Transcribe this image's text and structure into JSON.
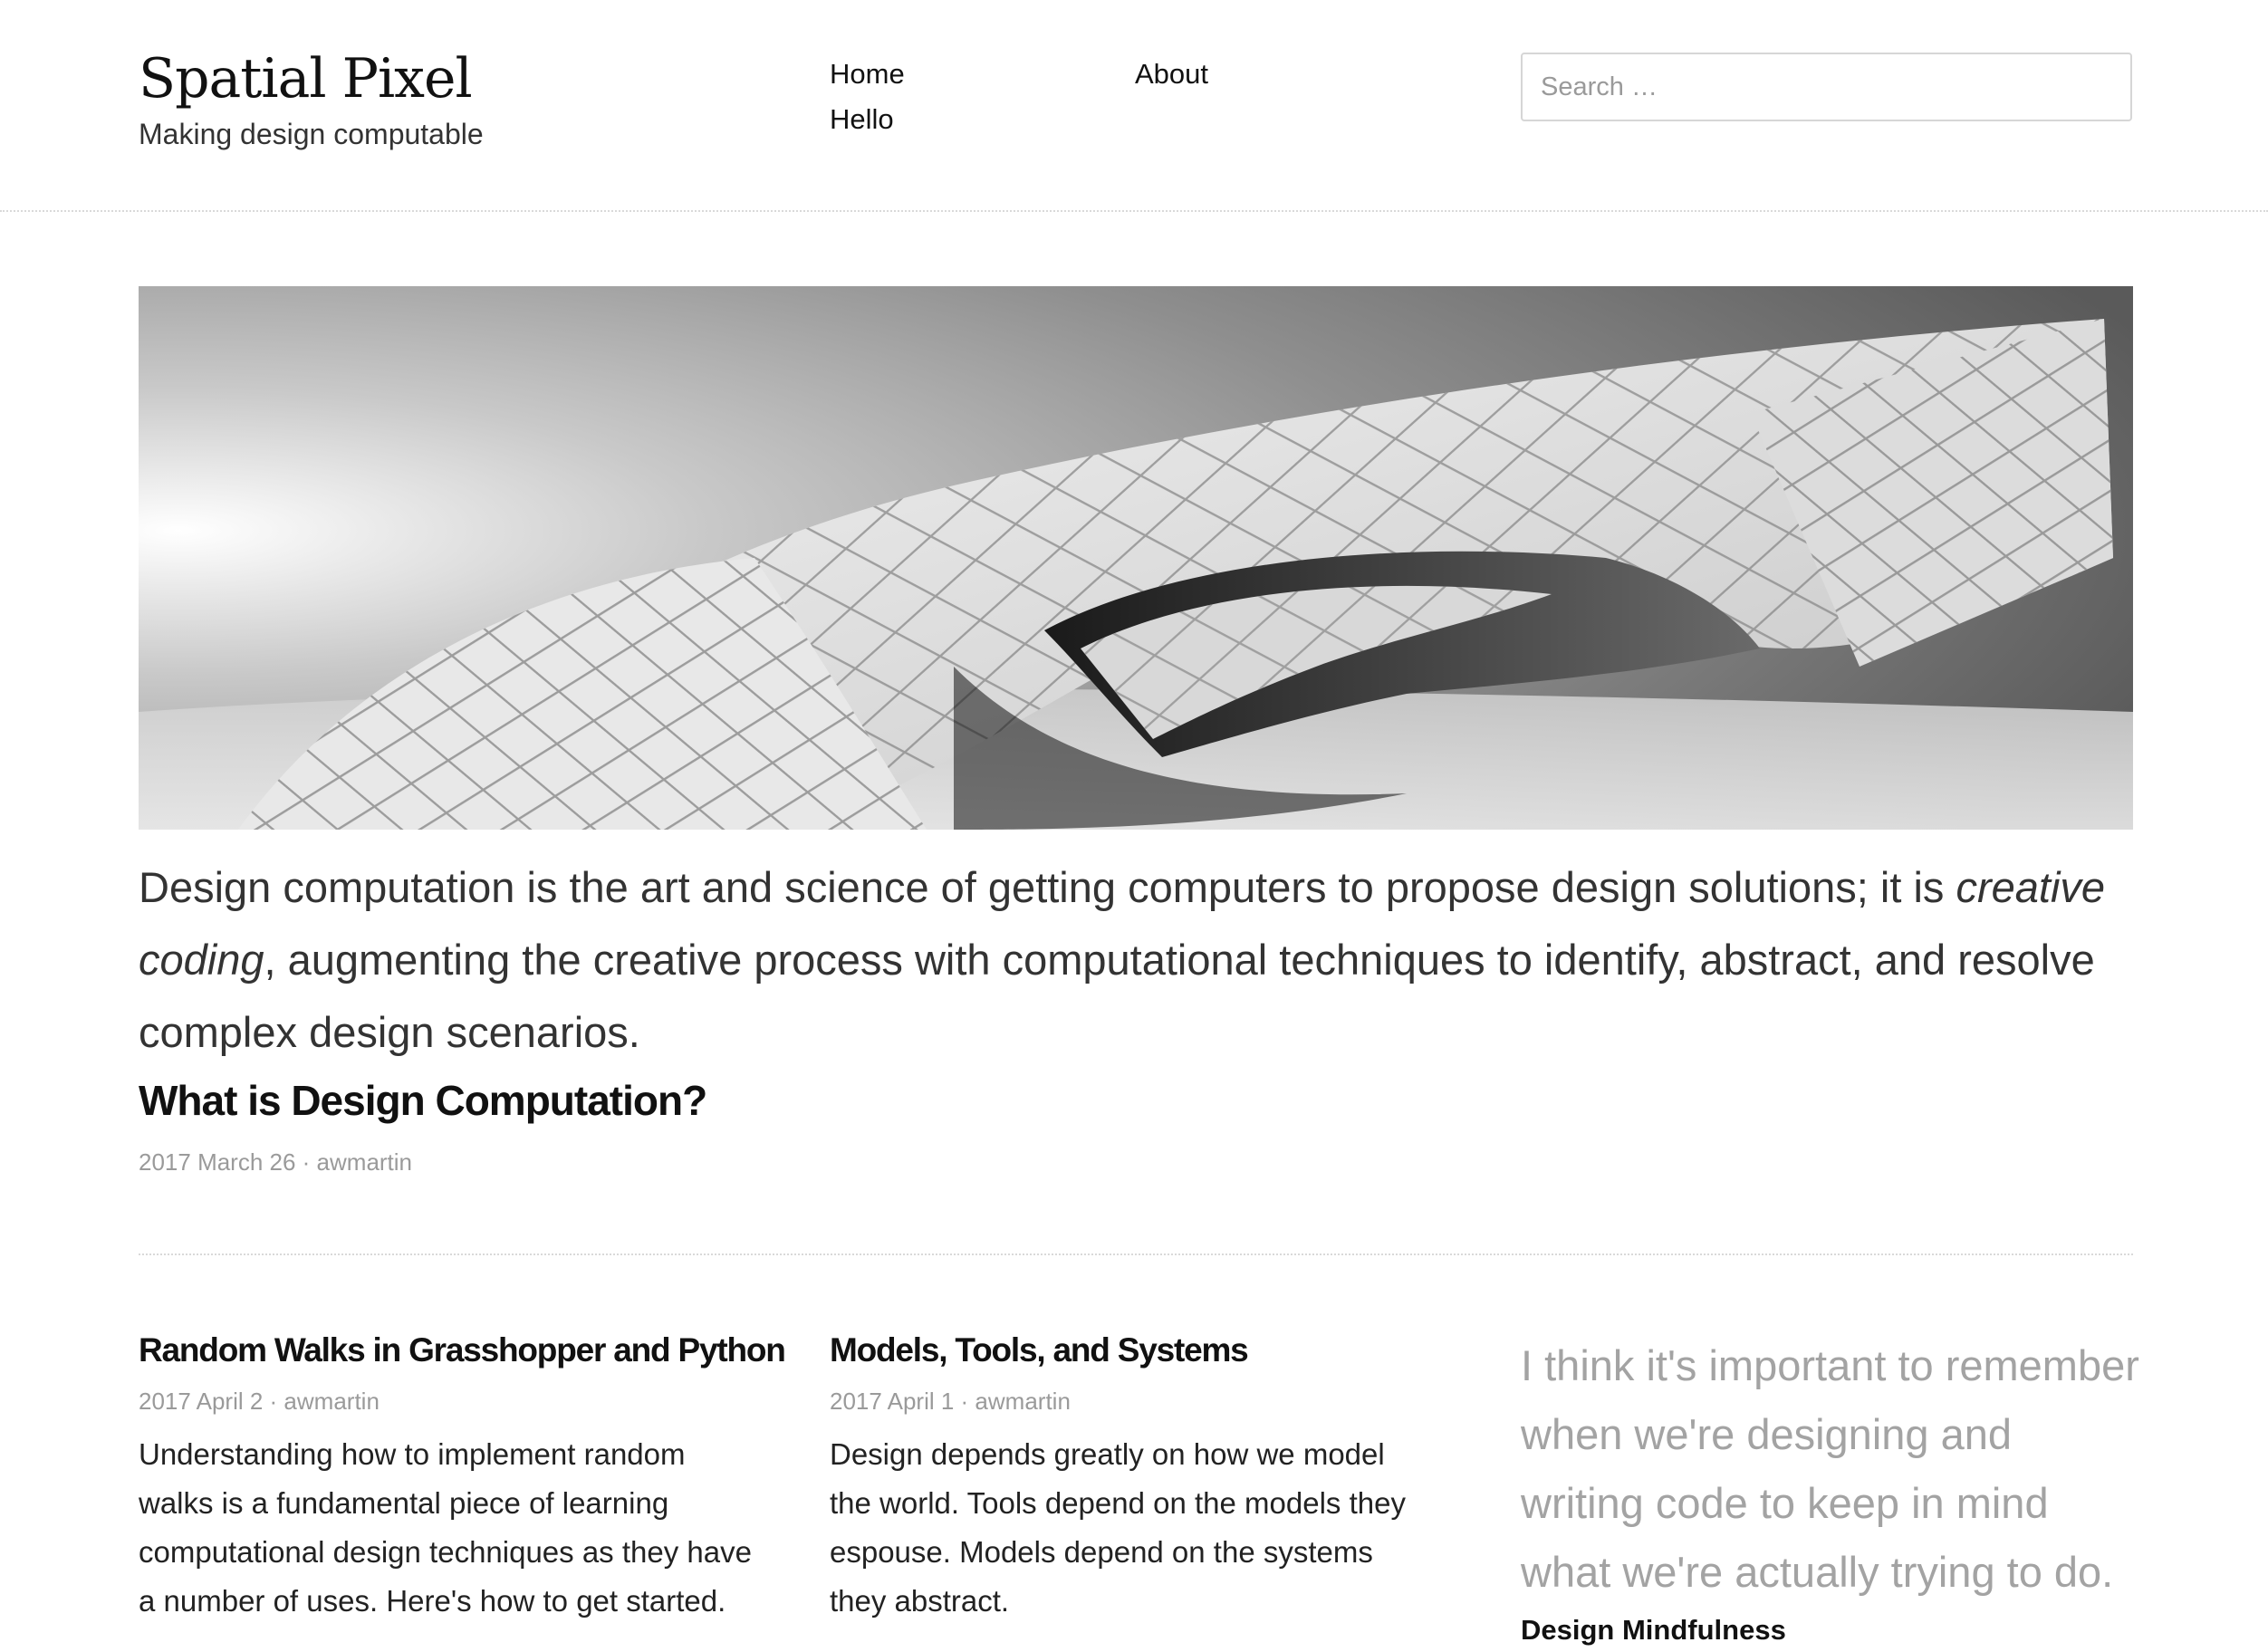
{
  "site": {
    "title": "Spatial Pixel",
    "tagline": "Making design computable"
  },
  "nav": {
    "items": [
      {
        "label": "Home"
      },
      {
        "label": "About"
      },
      {
        "label": "Hello"
      }
    ]
  },
  "search": {
    "placeholder": "Search …"
  },
  "hero": {
    "image_description": "grayscale render of a curved paneled lattice shell structure"
  },
  "intro": {
    "text_before": "Design computation is the art and science of getting computers to propose design solutions; it is ",
    "emphasis": "creative coding",
    "text_after": ", augmenting the creative process with computational techniques to identify, abstract, and resolve complex design scenarios."
  },
  "featured": {
    "title": "What is Design Computation?",
    "meta": "2017 March 26 · awmartin"
  },
  "posts": [
    {
      "title": "Random Walks in Grasshopper and Python",
      "meta": "2017 April 2 · awmartin",
      "excerpt": "Understanding how to implement random walks is a fundamental piece of learning computational design techniques as they have a number of uses. Here's how to get started."
    },
    {
      "title": "Models, Tools, and Systems",
      "meta": "2017 April 1 · awmartin",
      "excerpt": "Design depends greatly on how we model the world. Tools depend on the models they espouse. Models depend on the systems they abstract."
    }
  ],
  "quote": {
    "text": "I think it's important to remember when we're designing and writing code to keep in mind what we're actually trying to do.",
    "source": "Design Mindfulness"
  },
  "colors": {
    "text": "#222222",
    "meta": "#9a9a9a",
    "quote": "#a3a3a3",
    "divider": "#d9d9d9"
  }
}
